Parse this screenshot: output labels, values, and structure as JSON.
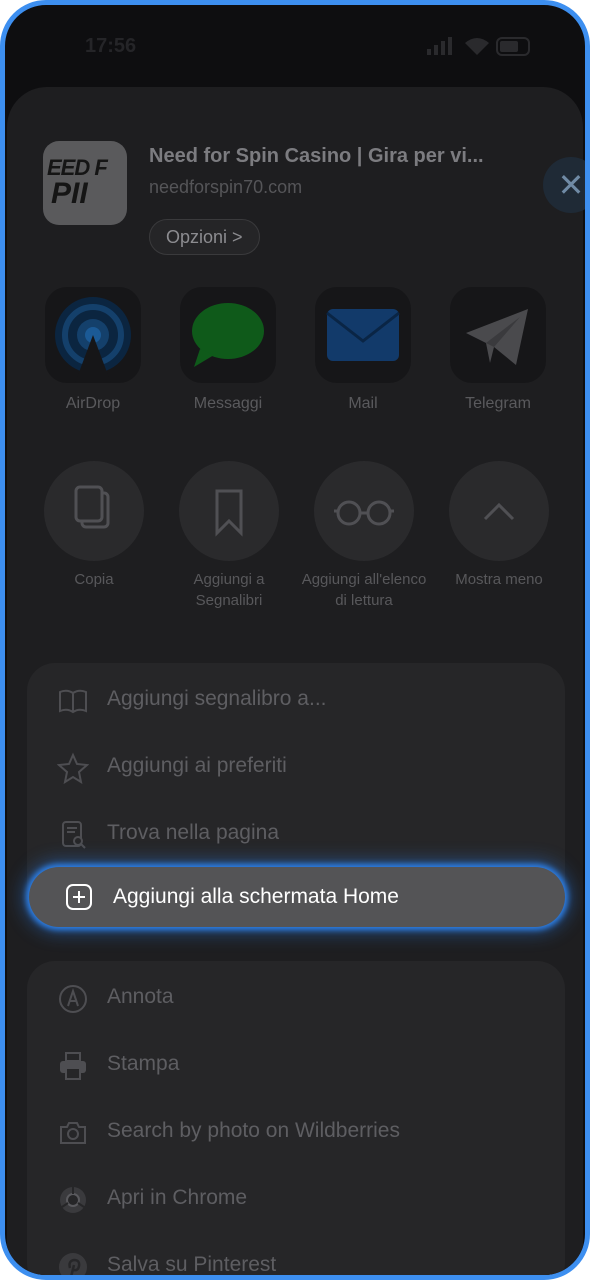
{
  "status_bar": {
    "time": "17:56"
  },
  "header": {
    "page_title": "Need for Spin Casino | Gira per vi...",
    "domain": "needforspin70.com",
    "options_label": "Opzioni >",
    "thumb_logo_line1": "EED F",
    "thumb_logo_line2": "PII"
  },
  "share_targets": [
    {
      "label": "AirDrop",
      "icon": "airdrop-icon"
    },
    {
      "label": "Messaggi",
      "icon": "messages-icon"
    },
    {
      "label": "Mail",
      "icon": "mail-icon"
    },
    {
      "label": "Telegram",
      "icon": "telegram-icon"
    }
  ],
  "actions": [
    {
      "label": "Copia",
      "icon": "copy-icon"
    },
    {
      "label": "Aggiungi a Segnalibri",
      "icon": "bookmark-icon"
    },
    {
      "label": "Aggiungi all'elenco di lettura",
      "icon": "reading-glasses-icon"
    },
    {
      "label": "Mostra meno",
      "icon": "chevron-up-icon"
    }
  ],
  "menu_group_1": [
    {
      "label": "Aggiungi segnalibro a...",
      "icon": "book-icon"
    },
    {
      "label": "Aggiungi ai preferiti",
      "icon": "star-icon"
    },
    {
      "label": "Trova nella pagina",
      "icon": "find-in-page-icon"
    },
    {
      "label": "Aggiungi alla schermata Home",
      "icon": "plus-square-icon",
      "highlighted": true
    }
  ],
  "menu_group_2": [
    {
      "label": "Annota",
      "icon": "markup-icon"
    },
    {
      "label": "Stampa",
      "icon": "printer-icon"
    },
    {
      "label": "Search by photo on Wildberries",
      "icon": "camera-icon"
    },
    {
      "label": "Apri in Chrome",
      "icon": "chrome-icon"
    },
    {
      "label": "Salva su Pinterest",
      "icon": "pinterest-icon"
    }
  ],
  "colors": {
    "highlight_glow": "#2d7fe6",
    "frame_border": "#3d8ff0"
  }
}
